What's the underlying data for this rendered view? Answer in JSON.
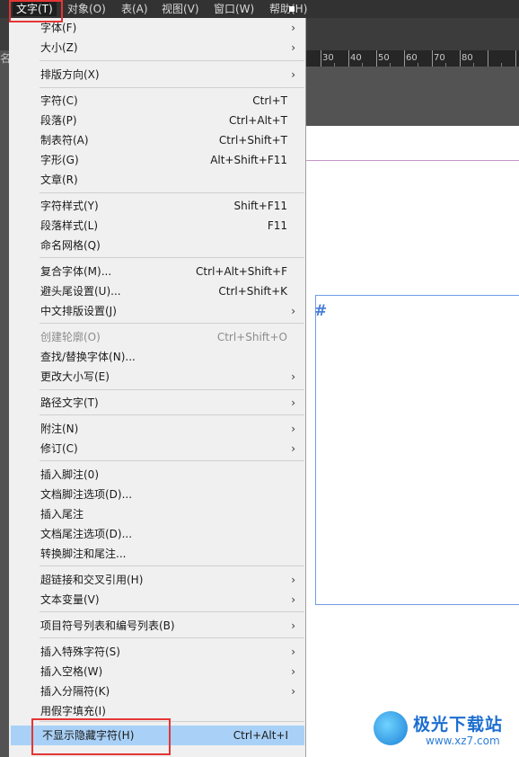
{
  "menubar": {
    "items": [
      {
        "label": "文字(T)"
      },
      {
        "label": "对象(O)"
      },
      {
        "label": "表(A)"
      },
      {
        "label": "视图(V)"
      },
      {
        "label": "窗口(W)"
      },
      {
        "label": "帮助(H)"
      }
    ]
  },
  "toolbar": {
    "fragment": "名"
  },
  "ruler": {
    "labels": [
      "30",
      "40",
      "50",
      "60",
      "70",
      "80"
    ]
  },
  "frame": {
    "glyph": "#"
  },
  "menu": {
    "items": [
      {
        "label": "字体(F)",
        "shortcut": "",
        "submenu": true
      },
      {
        "label": "大小(Z)",
        "shortcut": "",
        "submenu": true
      },
      {
        "label": "排版方向(X)",
        "shortcut": "",
        "submenu": true
      },
      {
        "label": "字符(C)",
        "shortcut": "Ctrl+T",
        "submenu": false
      },
      {
        "label": "段落(P)",
        "shortcut": "Ctrl+Alt+T",
        "submenu": false
      },
      {
        "label": "制表符(A)",
        "shortcut": "Ctrl+Shift+T",
        "submenu": false
      },
      {
        "label": "字形(G)",
        "shortcut": "Alt+Shift+F11",
        "submenu": false
      },
      {
        "label": "文章(R)",
        "shortcut": "",
        "submenu": false
      },
      {
        "label": "字符样式(Y)",
        "shortcut": "Shift+F11",
        "submenu": false
      },
      {
        "label": "段落样式(L)",
        "shortcut": "F11",
        "submenu": false
      },
      {
        "label": "命名网格(Q)",
        "shortcut": "",
        "submenu": false
      },
      {
        "label": "复合字体(M)...",
        "shortcut": "Ctrl+Alt+Shift+F",
        "submenu": false
      },
      {
        "label": "避头尾设置(U)...",
        "shortcut": "Ctrl+Shift+K",
        "submenu": false
      },
      {
        "label": "中文排版设置(J)",
        "shortcut": "",
        "submenu": true
      },
      {
        "label": "创建轮廓(O)",
        "shortcut": "Ctrl+Shift+O",
        "submenu": false,
        "disabled": true
      },
      {
        "label": "查找/替换字体(N)...",
        "shortcut": "",
        "submenu": false
      },
      {
        "label": "更改大小写(E)",
        "shortcut": "",
        "submenu": true
      },
      {
        "label": "路径文字(T)",
        "shortcut": "",
        "submenu": true
      },
      {
        "label": "附注(N)",
        "shortcut": "",
        "submenu": true
      },
      {
        "label": "修订(C)",
        "shortcut": "",
        "submenu": true
      },
      {
        "label": "插入脚注(0)",
        "shortcut": "",
        "submenu": false
      },
      {
        "label": "文档脚注选项(D)...",
        "shortcut": "",
        "submenu": false
      },
      {
        "label": "插入尾注",
        "shortcut": "",
        "submenu": false
      },
      {
        "label": "文档尾注选项(D)...",
        "shortcut": "",
        "submenu": false
      },
      {
        "label": "转换脚注和尾注...",
        "shortcut": "",
        "submenu": false
      },
      {
        "label": "超链接和交叉引用(H)",
        "shortcut": "",
        "submenu": true
      },
      {
        "label": "文本变量(V)",
        "shortcut": "",
        "submenu": true
      },
      {
        "label": "项目符号列表和编号列表(B)",
        "shortcut": "",
        "submenu": true
      },
      {
        "label": "插入特殊字符(S)",
        "shortcut": "",
        "submenu": true
      },
      {
        "label": "插入空格(W)",
        "shortcut": "",
        "submenu": true
      },
      {
        "label": "插入分隔符(K)",
        "shortcut": "",
        "submenu": true
      },
      {
        "label": "用假字填充(I)",
        "shortcut": "",
        "submenu": false
      },
      {
        "label": "不显示隐藏字符(H)",
        "shortcut": "Ctrl+Alt+I",
        "submenu": false,
        "highlighted": true
      }
    ],
    "arrow_glyph": "›"
  },
  "watermark": {
    "title": "极光下载站",
    "url": "www.xz7.com"
  },
  "colors": {
    "highlight": "#a9d1f7",
    "annotation": "#e53535",
    "menubar": "#323232"
  }
}
